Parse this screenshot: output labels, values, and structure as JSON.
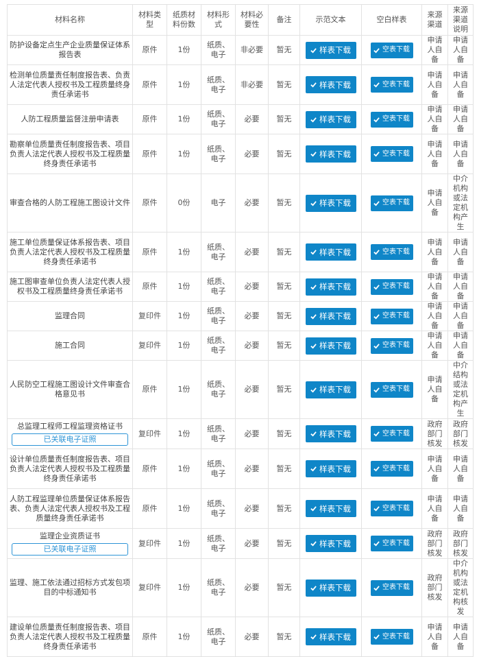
{
  "headers": {
    "name": "材料名称",
    "type": "材料类型",
    "copies": "纸质材料份数",
    "form": "材料形式",
    "required": "材料必要性",
    "note": "备注",
    "sample": "示范文本",
    "blank": "空白样表",
    "source": "来源渠道",
    "source_desc": "来源渠道说明"
  },
  "buttons": {
    "sample": "样表下载",
    "blank": "空表下载"
  },
  "linked_tag": "已关联电子证照",
  "colors": {
    "button": "#0f86c8",
    "tag": "#2b93d6",
    "border": "#e2e2e2"
  },
  "rows": [
    {
      "name": "防护设备定点生产企业质量保证体系报告表",
      "type": "原件",
      "copies": "1份",
      "form": "纸质、电子",
      "required": "非必要",
      "note": "暂无",
      "source": "申请人自备",
      "source_desc": "申请人自备"
    },
    {
      "name": "检测单位质量责任制度报告表、负责人法定代表人授权书及工程质量终身责任承诺书",
      "type": "原件",
      "copies": "1份",
      "form": "纸质、电子",
      "required": "非必要",
      "note": "暂无",
      "source": "申请人自备",
      "source_desc": "申请人自备"
    },
    {
      "name": "人防工程质量监督注册申请表",
      "type": "原件",
      "copies": "1份",
      "form": "纸质、电子",
      "required": "必要",
      "note": "暂无",
      "source": "申请人自备",
      "source_desc": "申请人自备"
    },
    {
      "name": "勘察单位质量责任制度报告表、项目负责人法定代表人授权书及工程质量终身责任承诺书",
      "type": "原件",
      "copies": "1份",
      "form": "纸质、电子",
      "required": "必要",
      "note": "暂无",
      "source": "申请人自备",
      "source_desc": "申请人自备"
    },
    {
      "name": "审查合格的人防工程施工图设计文件",
      "type": "原件",
      "copies": "0份",
      "form": "电子",
      "required": "必要",
      "note": "暂无",
      "source": "申请人自备",
      "source_desc": "中介机构或法定机构产生"
    },
    {
      "name": "施工单位质量保证体系报告表、项目负责人法定代表人授权书及工程质量终身责任承诺书",
      "type": "原件",
      "copies": "1份",
      "form": "纸质、电子",
      "required": "必要",
      "note": "暂无",
      "source": "申请人自备",
      "source_desc": "申请人自备"
    },
    {
      "name": "施工图审查单位负责人法定代表人授权书及工程质量终身责任承诺书",
      "type": "原件",
      "copies": "1份",
      "form": "纸质、电子",
      "required": "必要",
      "note": "暂无",
      "source": "申请人自备",
      "source_desc": "申请人自备"
    },
    {
      "name": "监理合同",
      "type": "复印件",
      "copies": "1份",
      "form": "纸质、电子",
      "required": "必要",
      "note": "暂无",
      "source": "申请人自备",
      "source_desc": "申请人自备"
    },
    {
      "name": "施工合同",
      "type": "复印件",
      "copies": "1份",
      "form": "纸质、电子",
      "required": "必要",
      "note": "暂无",
      "source": "申请人自备",
      "source_desc": "申请人自备"
    },
    {
      "name": "人民防空工程施工图设计文件审查合格意见书",
      "type": "原件",
      "copies": "1份",
      "form": "纸质、电子",
      "required": "必要",
      "note": "暂无",
      "source": "申请人自备",
      "source_desc": "中介结构或法定机构产生"
    },
    {
      "name": "总监理工程师工程监理资格证书",
      "type": "复印件",
      "copies": "1份",
      "form": "纸质、电子",
      "required": "必要",
      "note": "暂无",
      "source": "政府部门核发",
      "source_desc": "政府部门核发",
      "linked": true
    },
    {
      "name": "设计单位质量责任制度报告表、项目负责人法定代表人授权书及工程质量终身责任承诺书",
      "type": "原件",
      "copies": "1份",
      "form": "纸质、电子",
      "required": "必要",
      "note": "暂无",
      "source": "申请人自备",
      "source_desc": "申请人自备"
    },
    {
      "name": "人防工程监理单位质量保证体系报告表、负责人法定代表人授权书及工程质量终身责任承诺书",
      "type": "原件",
      "copies": "1份",
      "form": "纸质、电子",
      "required": "必要",
      "note": "暂无",
      "source": "申请人自备",
      "source_desc": "申请人自备"
    },
    {
      "name": "监理企业资质证书",
      "type": "复印件",
      "copies": "1份",
      "form": "纸质、电子",
      "required": "必要",
      "note": "暂无",
      "source": "政府部门核发",
      "source_desc": "政府部门核发",
      "linked": true
    },
    {
      "name": "监理、施工依法通过招标方式发包项目的中标通知书",
      "type": "复印件",
      "copies": "1份",
      "form": "纸质、电子",
      "required": "必要",
      "note": "暂无",
      "source": "政府部门核发",
      "source_desc": "中介机构或法定机构核发"
    },
    {
      "name": "建设单位质量责任制度报告表、项目负责人法定代表人授权书及工程质量终身责任承诺书",
      "type": "原件",
      "copies": "1份",
      "form": "纸质、电子",
      "required": "必要",
      "note": "暂无",
      "source": "申请人自备",
      "source_desc": "申请人自备"
    }
  ]
}
